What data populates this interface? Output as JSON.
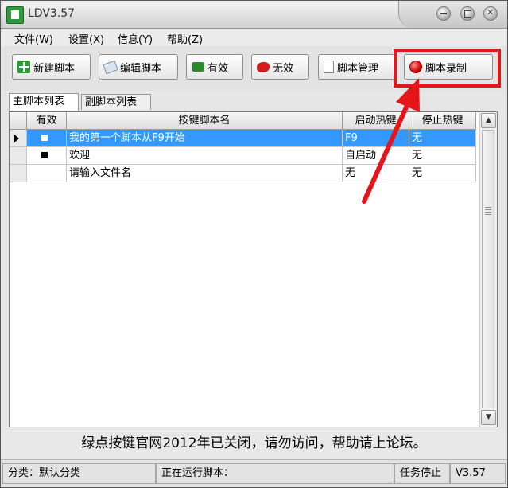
{
  "window": {
    "title": "LDV3.57"
  },
  "menu": [
    "文件(W)",
    "设置(X)",
    "信息(Y)",
    "帮助(Z)"
  ],
  "toolbar": {
    "new_script": "新建脚本",
    "edit_script": "编辑脚本",
    "valid": "有效",
    "invalid": "无效",
    "script_manage": "脚本管理",
    "script_record": "脚本录制"
  },
  "tabs": [
    "主脚本列表",
    "副脚本列表"
  ],
  "table": {
    "columns": [
      "有效",
      "按键脚本名",
      "启动热键",
      "停止热键"
    ],
    "rows": [
      {
        "name": "我的第一个脚本从F9开始",
        "start": "F9",
        "stop": "无"
      },
      {
        "name": "欢迎",
        "start": "自启动",
        "stop": "无"
      },
      {
        "name": "请输入文件名",
        "start": "无",
        "stop": "无"
      }
    ]
  },
  "notice": "绿点按键官网2012年已关闭，请勿访问，帮助请上论坛。",
  "status": {
    "category": "分类：默认分类",
    "running": "正在运行脚本：",
    "task": "任务停止",
    "version": "V3.57"
  },
  "colors": {
    "selection": "#3399ff",
    "highlight_box": "#e5151c",
    "arrow": "#e5151c"
  },
  "icons": [
    "app-icon",
    "minimize-icon",
    "maximize-icon",
    "close-icon",
    "plus-icon",
    "tag-icon",
    "valid-icon",
    "invalid-icon",
    "document-icon",
    "record-icon",
    "row-pointer-icon",
    "scroll-up-icon",
    "scroll-down-icon"
  ]
}
